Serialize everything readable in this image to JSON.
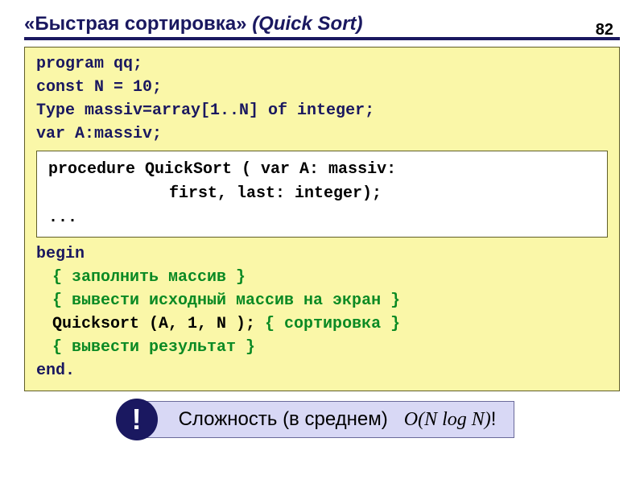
{
  "page_number": "82",
  "title": {
    "ru": "«Быстрая сортировка» ",
    "en": "(Quick Sort)"
  },
  "code": {
    "l1": "program qq;",
    "l2": "const N = 10;",
    "l3": "Type massiv=array[1..N] of integer;",
    "l4": "var A:massiv;",
    "proc1": "procedure QuickSort ( var A: massiv:",
    "proc2": "first, last: integer);",
    "proc3": "...",
    "l5": "begin",
    "l6": "{ заполнить массив }",
    "l7": "{ вывести исходный массив на экран }",
    "l8a": "Quicksort (A, 1, N ); ",
    "l8b": "{ сортировка }",
    "l9": "{ вывести результат }",
    "l10": "end."
  },
  "complexity": {
    "bang": "!",
    "label": "Сложность (в среднем)",
    "formula": "O(N log N)",
    "trail": "!"
  }
}
